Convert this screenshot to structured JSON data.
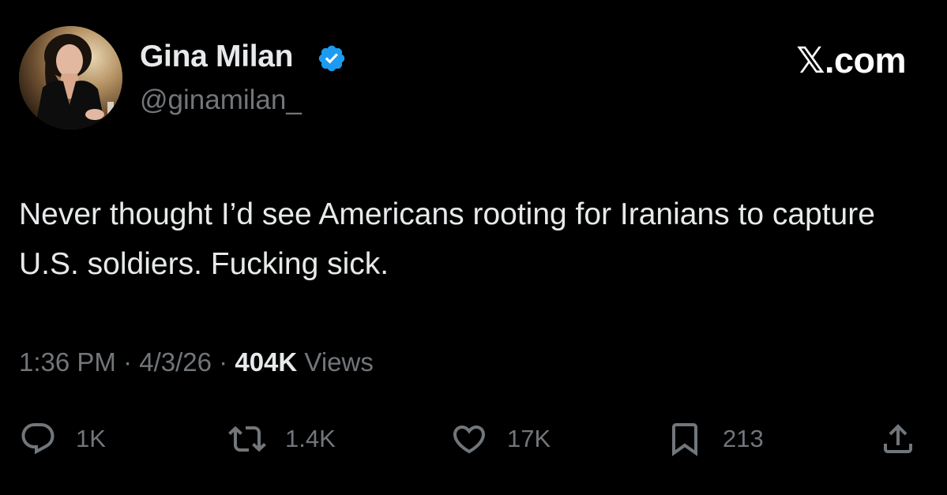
{
  "author": {
    "display_name": "Gina Milan",
    "handle": "@ginamilan_",
    "verified": true,
    "verified_color": "#1d9bf0"
  },
  "brand": "𝕏.com",
  "tweet": {
    "text": "Never thought I’d see Americans rooting for Iranians to capture U.S. soldiers. Fucking sick."
  },
  "meta": {
    "time": "1:36 PM",
    "sep1": "·",
    "date": "4/3/26",
    "sep2": "·",
    "views_count": "404K",
    "views_label": "Views"
  },
  "actions": {
    "reply": {
      "icon": "reply-icon",
      "count": "1K"
    },
    "retweet": {
      "icon": "retweet-icon",
      "count": "1.4K"
    },
    "like": {
      "icon": "heart-icon",
      "count": "17K"
    },
    "bookmark": {
      "icon": "bookmark-icon",
      "count": "213"
    },
    "share": {
      "icon": "share-icon"
    }
  },
  "colors": {
    "background": "#000000",
    "primary_text": "#e7e9ea",
    "secondary_text": "#71767b"
  }
}
